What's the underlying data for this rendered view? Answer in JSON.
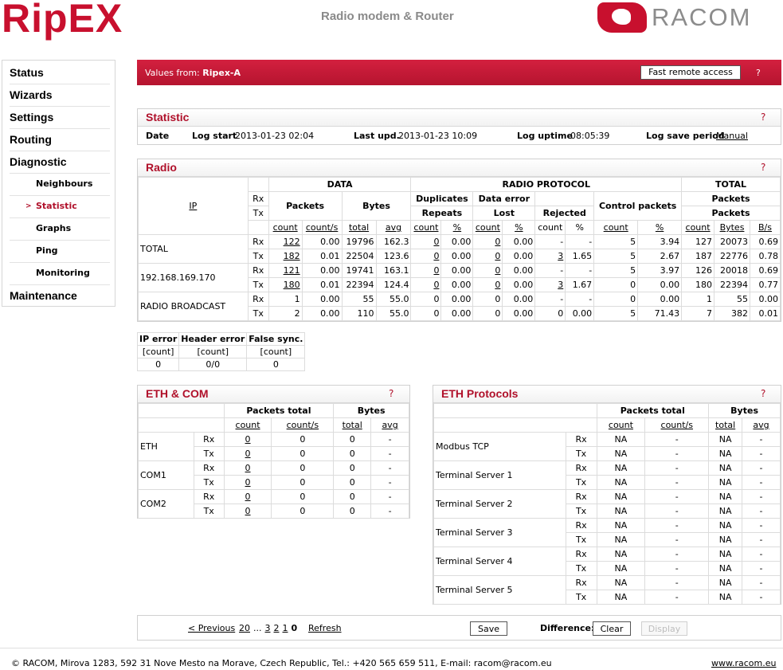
{
  "header": {
    "logo_text": "RipEX",
    "subtitle": "Radio modem & Router",
    "brand_text": "RACOM"
  },
  "sidebar": {
    "items": [
      {
        "label": "Status",
        "level": 0
      },
      {
        "label": "Wizards",
        "level": 0
      },
      {
        "label": "Settings",
        "level": 0
      },
      {
        "label": "Routing",
        "level": 0
      },
      {
        "label": "Diagnostic",
        "level": 0
      },
      {
        "label": "Neighbours",
        "level": 1
      },
      {
        "label": "Statistic",
        "level": 1,
        "active": true
      },
      {
        "label": "Graphs",
        "level": 1
      },
      {
        "label": "Ping",
        "level": 1
      },
      {
        "label": "Monitoring",
        "level": 1
      },
      {
        "label": "Maintenance",
        "level": 0
      }
    ],
    "active_marker": ">"
  },
  "values_bar": {
    "prefix": "Values from:",
    "unit_name": "Ripex-A",
    "fast_remote_label": "Fast remote access",
    "help": "?"
  },
  "statistic": {
    "title": "Statistic",
    "help": "?",
    "date_label": "Date",
    "log_start_label": "Log start",
    "log_start_value": "2013-01-23 02:04",
    "last_upd_label": "Last upd.",
    "last_upd_value": "2013-01-23 10:09",
    "log_uptime_label": "Log uptime",
    "log_uptime_value": "08:05:39",
    "log_save_label": "Log save period",
    "log_save_value": "Manual"
  },
  "radio": {
    "title": "Radio",
    "help": "?",
    "headers": {
      "ip": "IP",
      "rx": "Rx",
      "tx": "Tx",
      "data": "DATA",
      "radio_protocol": "RADIO PROTOCOL",
      "total": "TOTAL",
      "packets": "Packets",
      "bytes": "Bytes",
      "duplicates": "Duplicates",
      "repeats": "Repeats",
      "data_error": "Data error",
      "lost": "Lost",
      "rejected": "Rejected",
      "control_packets": "Control packets",
      "total_packets": "Packets",
      "total_packets2": "Packets",
      "count": "count",
      "count_s": "count/s",
      "total_bytes": "total",
      "avg": "avg",
      "pct": "%",
      "bytes_col": "Bytes",
      "bps": "B/s"
    },
    "rows": [
      {
        "name": "TOTAL",
        "dir": "Rx",
        "cells": [
          "122",
          "0.00",
          "19796",
          "162.3",
          "0",
          "0.00",
          "0",
          "0.00",
          "-",
          "-",
          "5",
          "3.94",
          "127",
          "20073",
          "0.69"
        ]
      },
      {
        "name": "",
        "dir": "Tx",
        "cells": [
          "182",
          "0.01",
          "22504",
          "123.6",
          "0",
          "0.00",
          "0",
          "0.00",
          "3",
          "1.65",
          "5",
          "2.67",
          "187",
          "22776",
          "0.78"
        ]
      },
      {
        "name": "192.168.169.170",
        "dir": "Rx",
        "cells": [
          "121",
          "0.00",
          "19741",
          "163.1",
          "0",
          "0.00",
          "0",
          "0.00",
          "-",
          "-",
          "5",
          "3.97",
          "126",
          "20018",
          "0.69"
        ]
      },
      {
        "name": "",
        "dir": "Tx",
        "cells": [
          "180",
          "0.01",
          "22394",
          "124.4",
          "0",
          "0.00",
          "0",
          "0.00",
          "3",
          "1.67",
          "0",
          "0.00",
          "180",
          "22394",
          "0.77"
        ]
      },
      {
        "name": "RADIO BROADCAST",
        "dir": "Rx",
        "cells": [
          "1",
          "0.00",
          "55",
          "55.0",
          "0",
          "0.00",
          "0",
          "0.00",
          "-",
          "-",
          "0",
          "0.00",
          "1",
          "55",
          "0.00"
        ]
      },
      {
        "name": "",
        "dir": "Tx",
        "cells": [
          "2",
          "0.00",
          "110",
          "55.0",
          "0",
          "0.00",
          "0",
          "0.00",
          "0",
          "0.00",
          "5",
          "71.43",
          "7",
          "382",
          "0.01"
        ]
      }
    ]
  },
  "errors": {
    "headers": [
      "IP error",
      "Header error",
      "False sync."
    ],
    "units": [
      "[count]",
      "[count]",
      "[count]"
    ],
    "values": [
      "0",
      "0/0",
      "0"
    ]
  },
  "eth_com": {
    "title": "ETH & COM",
    "help": "?",
    "headers": {
      "packets_total": "Packets total",
      "bytes": "Bytes",
      "count": "count",
      "count_s": "count/s",
      "total": "total",
      "avg": "avg"
    },
    "rows": [
      {
        "name": "ETH",
        "dir": "Rx",
        "cells": [
          "0",
          "0",
          "0",
          "-"
        ]
      },
      {
        "name": "",
        "dir": "Tx",
        "cells": [
          "0",
          "0",
          "0",
          "-"
        ]
      },
      {
        "name": "COM1",
        "dir": "Rx",
        "cells": [
          "0",
          "0",
          "0",
          "-"
        ]
      },
      {
        "name": "",
        "dir": "Tx",
        "cells": [
          "0",
          "0",
          "0",
          "-"
        ]
      },
      {
        "name": "COM2",
        "dir": "Rx",
        "cells": [
          "0",
          "0",
          "0",
          "-"
        ]
      },
      {
        "name": "",
        "dir": "Tx",
        "cells": [
          "0",
          "0",
          "0",
          "-"
        ]
      }
    ]
  },
  "eth_protocols": {
    "title": "ETH Protocols",
    "help": "?",
    "headers": {
      "packets_total": "Packets total",
      "bytes": "Bytes",
      "count": "count",
      "count_s": "count/s",
      "total": "total",
      "avg": "avg"
    },
    "rows": [
      {
        "name": "Modbus TCP",
        "dir": "Rx",
        "cells": [
          "NA",
          "-",
          "NA",
          "-"
        ]
      },
      {
        "name": "",
        "dir": "Tx",
        "cells": [
          "NA",
          "-",
          "NA",
          "-"
        ]
      },
      {
        "name": "Terminal Server 1",
        "dir": "Rx",
        "cells": [
          "NA",
          "-",
          "NA",
          "-"
        ]
      },
      {
        "name": "",
        "dir": "Tx",
        "cells": [
          "NA",
          "-",
          "NA",
          "-"
        ]
      },
      {
        "name": "Terminal Server 2",
        "dir": "Rx",
        "cells": [
          "NA",
          "-",
          "NA",
          "-"
        ]
      },
      {
        "name": "",
        "dir": "Tx",
        "cells": [
          "NA",
          "-",
          "NA",
          "-"
        ]
      },
      {
        "name": "Terminal Server 3",
        "dir": "Rx",
        "cells": [
          "NA",
          "-",
          "NA",
          "-"
        ]
      },
      {
        "name": "",
        "dir": "Tx",
        "cells": [
          "NA",
          "-",
          "NA",
          "-"
        ]
      },
      {
        "name": "Terminal Server 4",
        "dir": "Rx",
        "cells": [
          "NA",
          "-",
          "NA",
          "-"
        ]
      },
      {
        "name": "",
        "dir": "Tx",
        "cells": [
          "NA",
          "-",
          "NA",
          "-"
        ]
      },
      {
        "name": "Terminal Server 5",
        "dir": "Rx",
        "cells": [
          "NA",
          "-",
          "NA",
          "-"
        ]
      },
      {
        "name": "",
        "dir": "Tx",
        "cells": [
          "NA",
          "-",
          "NA",
          "-"
        ]
      }
    ]
  },
  "bottom_bar": {
    "previous": "< Previous",
    "pages": [
      "20",
      "...",
      "3",
      "2",
      "1",
      "0"
    ],
    "current_page": "0",
    "refresh": "Refresh",
    "save": "Save",
    "difference_label": "Difference:",
    "clear": "Clear",
    "display": "Display"
  },
  "footer": {
    "text": "© RACOM, Mirova 1283, 592 31 Nove Mesto na Morave, Czech Republic, Tel.: +420 565 659 511, E-mail: racom@racom.eu",
    "link": "www.racom.eu"
  },
  "colors": {
    "accent": "#c8102e",
    "brand_gray": "#8c8c8c"
  }
}
